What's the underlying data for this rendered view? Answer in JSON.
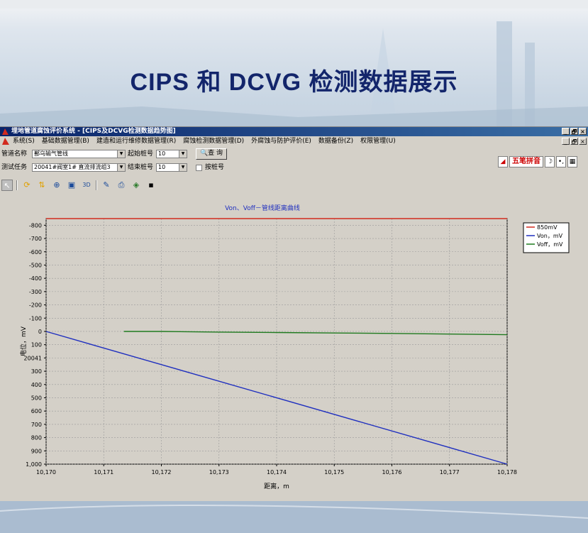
{
  "slide": {
    "title": "CIPS 和 DCVG 检测数据展示"
  },
  "window": {
    "title": "埋地管道腐蚀评价系统 - [CIPS及DCVG检测数据趋势图]",
    "buttons": [
      "_",
      "🗗",
      "×"
    ]
  },
  "menu": {
    "items": [
      "系统(S)",
      "基础数据管理(B)",
      "建造和运行维修数据管理(R)",
      "腐蚀检测数据管理(D)",
      "外腐蚀与防护评价(E)",
      "数据备份(Z)",
      "权限管理(U)"
    ]
  },
  "form": {
    "pipeline_label": "管道名称",
    "pipeline_value": "鄯乌输气管线",
    "task_label": "测试任务",
    "task_value": "20041#阀室1# 直流排流组3",
    "start_label": "起始桩号",
    "start_value": "10",
    "end_label": "结束桩号",
    "end_value": "10",
    "query_label": "查 询",
    "by_pile_label": "按桩号"
  },
  "ime": {
    "label": "五笔拼音"
  },
  "toolbar": {
    "icons": [
      "select-icon",
      "refresh-icon",
      "pan-icon",
      "zoom-icon",
      "fit-icon",
      "3d-icon",
      "edit-icon",
      "print-icon",
      "palette-icon",
      "save-icon"
    ],
    "three_d_label": "3D"
  },
  "colors": {
    "red": "#d22a1e",
    "blue": "#1f2fbf",
    "green": "#1f7a1f",
    "grid": "#9a9a9a"
  },
  "chart_data": {
    "type": "line",
    "title": "Von、Voff－管线距离曲线",
    "xlabel": "距离，m",
    "ylabel": "电位，mV",
    "x_ticks": [
      "10,170",
      "10,171",
      "10,172",
      "10,173",
      "10,174",
      "10,175",
      "10,176",
      "10,177",
      "10,178"
    ],
    "y_ticks": [
      "-800",
      "-700",
      "-600",
      "-500",
      "-400",
      "-300",
      "-200",
      "-100",
      "0",
      "100",
      "20041",
      "300",
      "400",
      "500",
      "600",
      "700",
      "800",
      "900",
      "1,000"
    ],
    "xlim": [
      10170,
      10178
    ],
    "ylim": [
      -850,
      1000
    ],
    "grid": true,
    "legend_position": "right",
    "series": [
      {
        "name": "850mV",
        "color": "#d22a1e",
        "x": [
          10170,
          10178
        ],
        "y": [
          -850,
          -850
        ]
      },
      {
        "name": "Von，mV",
        "color": "#1f2fbf",
        "x": [
          10170,
          10178
        ],
        "y": [
          0,
          1000
        ]
      },
      {
        "name": "Voff，mV",
        "color": "#1f7a1f",
        "x": [
          10171.35,
          10172.0,
          10173.0,
          10174.0,
          10175.0,
          10176.0,
          10177.0,
          10178.0
        ],
        "y": [
          0,
          0,
          5,
          8,
          12,
          15,
          20,
          25
        ]
      }
    ]
  }
}
